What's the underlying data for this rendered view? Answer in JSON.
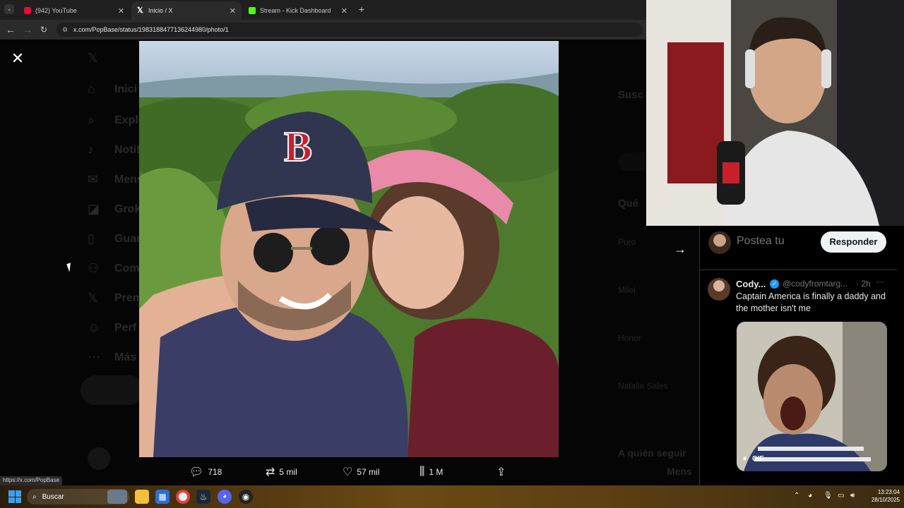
{
  "browser": {
    "tabs": [
      {
        "label": "(942) YouTube",
        "active": false,
        "icon": "youtube-icon",
        "color": "#ff0033"
      },
      {
        "label": "Inicio / X",
        "active": true,
        "icon": "x-logo-icon",
        "color": "#ffffff"
      },
      {
        "label": "Stream - Kick Dashboard",
        "active": false,
        "icon": "kick-icon",
        "color": "#53fc18"
      }
    ],
    "url": "x.com/PopBase/status/1983188477136244980/photo/1",
    "new_tab": "+",
    "status_url": "https://x.com/PopBase"
  },
  "sidebar_ghost": [
    "Inici",
    "Explo",
    "Notif",
    "Mens",
    "Grok",
    "Guar",
    "Com",
    "Prem",
    "Perf",
    "Más"
  ],
  "right_ghost": [
    "Susc",
    "Qué",
    "Puro",
    "Milei",
    "Honor",
    "Natalia Sales",
    "A quién seguir",
    "Mens"
  ],
  "tweet_actions": {
    "replies": "718",
    "reposts": "5 mil",
    "likes": "57 mil",
    "views": "1 M"
  },
  "reply_panel": {
    "placeholder": "Postea tu",
    "reply_button": "Responder",
    "tweet": {
      "name": "Cody...",
      "handle": "@codyfromtarg...",
      "time": "· 2h",
      "text": "Captain America is finally a daddy and the mother isn't me",
      "gif_label": "GIF"
    }
  },
  "taskbar": {
    "search_placeholder": "Buscar",
    "time": "13:23:04",
    "date": "28/10/2025"
  }
}
